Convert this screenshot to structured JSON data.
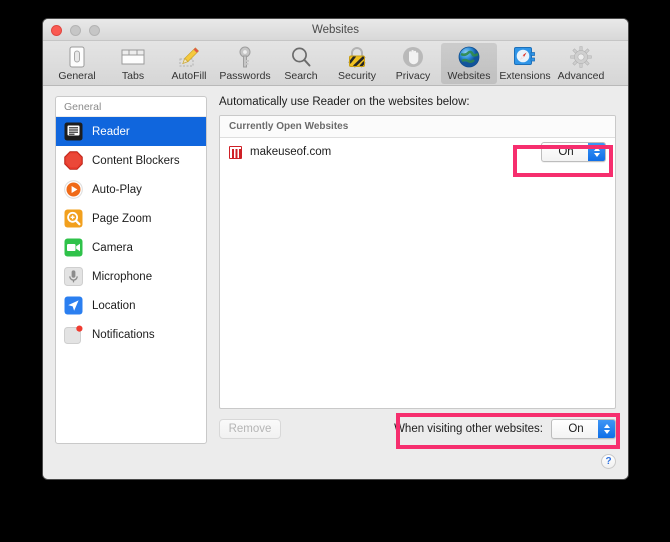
{
  "window": {
    "title": "Websites",
    "traffic_lights": [
      {
        "name": "close",
        "color": "#fa5a52"
      },
      {
        "name": "minimize",
        "color": "#c6c6c6"
      },
      {
        "name": "zoom",
        "color": "#c6c6c6"
      }
    ]
  },
  "toolbar": {
    "items": [
      {
        "label": "General",
        "icon": "general-icon",
        "selected": false
      },
      {
        "label": "Tabs",
        "icon": "tabs-icon",
        "selected": false
      },
      {
        "label": "AutoFill",
        "icon": "autofill-icon",
        "selected": false
      },
      {
        "label": "Passwords",
        "icon": "passwords-icon",
        "selected": false
      },
      {
        "label": "Search",
        "icon": "search-icon",
        "selected": false
      },
      {
        "label": "Security",
        "icon": "security-icon",
        "selected": false
      },
      {
        "label": "Privacy",
        "icon": "privacy-icon",
        "selected": false
      },
      {
        "label": "Websites",
        "icon": "websites-icon",
        "selected": true
      },
      {
        "label": "Extensions",
        "icon": "extensions-icon",
        "selected": false
      },
      {
        "label": "Advanced",
        "icon": "advanced-icon",
        "selected": false
      }
    ]
  },
  "sidebar": {
    "header": "General",
    "items": [
      {
        "label": "Reader",
        "icon": "reader-icon",
        "selected": true
      },
      {
        "label": "Content Blockers",
        "icon": "content-blockers-icon",
        "selected": false
      },
      {
        "label": "Auto-Play",
        "icon": "auto-play-icon",
        "selected": false
      },
      {
        "label": "Page Zoom",
        "icon": "page-zoom-icon",
        "selected": false
      },
      {
        "label": "Camera",
        "icon": "camera-icon",
        "selected": false
      },
      {
        "label": "Microphone",
        "icon": "microphone-icon",
        "selected": false
      },
      {
        "label": "Location",
        "icon": "location-icon",
        "selected": false
      },
      {
        "label": "Notifications",
        "icon": "notifications-icon",
        "selected": false
      }
    ]
  },
  "main": {
    "caption": "Automatically use Reader on the websites below:",
    "list_header": "Currently Open Websites",
    "rows": [
      {
        "site": "makeuseof.com",
        "favicon": "makeuseof-favicon",
        "setting": "On"
      }
    ],
    "remove_button": "Remove",
    "other_websites_label": "When visiting other websites:",
    "other_websites_value": "On",
    "help_button": "?"
  },
  "colors": {
    "selection_blue": "#1066dd",
    "annotation_pink": "#f62e6e",
    "popup_arrow_blue": "#0f6fe8"
  }
}
